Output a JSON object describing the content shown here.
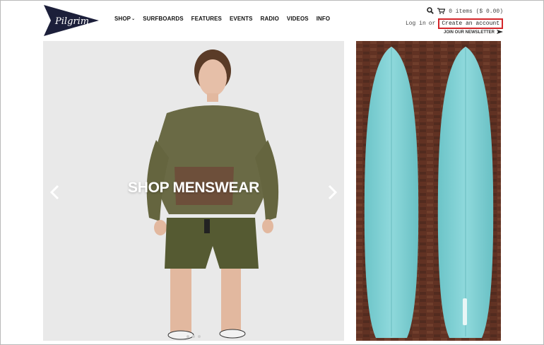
{
  "brand": {
    "logo_text": "Pilgrim",
    "color": "#1c1f3a"
  },
  "nav": [
    {
      "label": "SHOP",
      "has_dropdown": true
    },
    {
      "label": "SURFBOARDS"
    },
    {
      "label": "FEATURES"
    },
    {
      "label": "EVENTS"
    },
    {
      "label": "RADIO"
    },
    {
      "label": "VIDEOS"
    },
    {
      "label": "INFO"
    }
  ],
  "header_tools": {
    "cart_text": "0 items ($ 0.00)",
    "login_text": "Log in",
    "or_text": "or",
    "create_account_text": "Create an account",
    "newsletter_text": "JOIN OUR NEWSLETTER",
    "highlight_color": "#d3262a"
  },
  "hero": {
    "caption": "SHOP MENSWEAR",
    "slide_count": 3
  },
  "side_feature": {
    "board_color": "#7fd0d3",
    "wall_color": "#6b3a2a"
  }
}
